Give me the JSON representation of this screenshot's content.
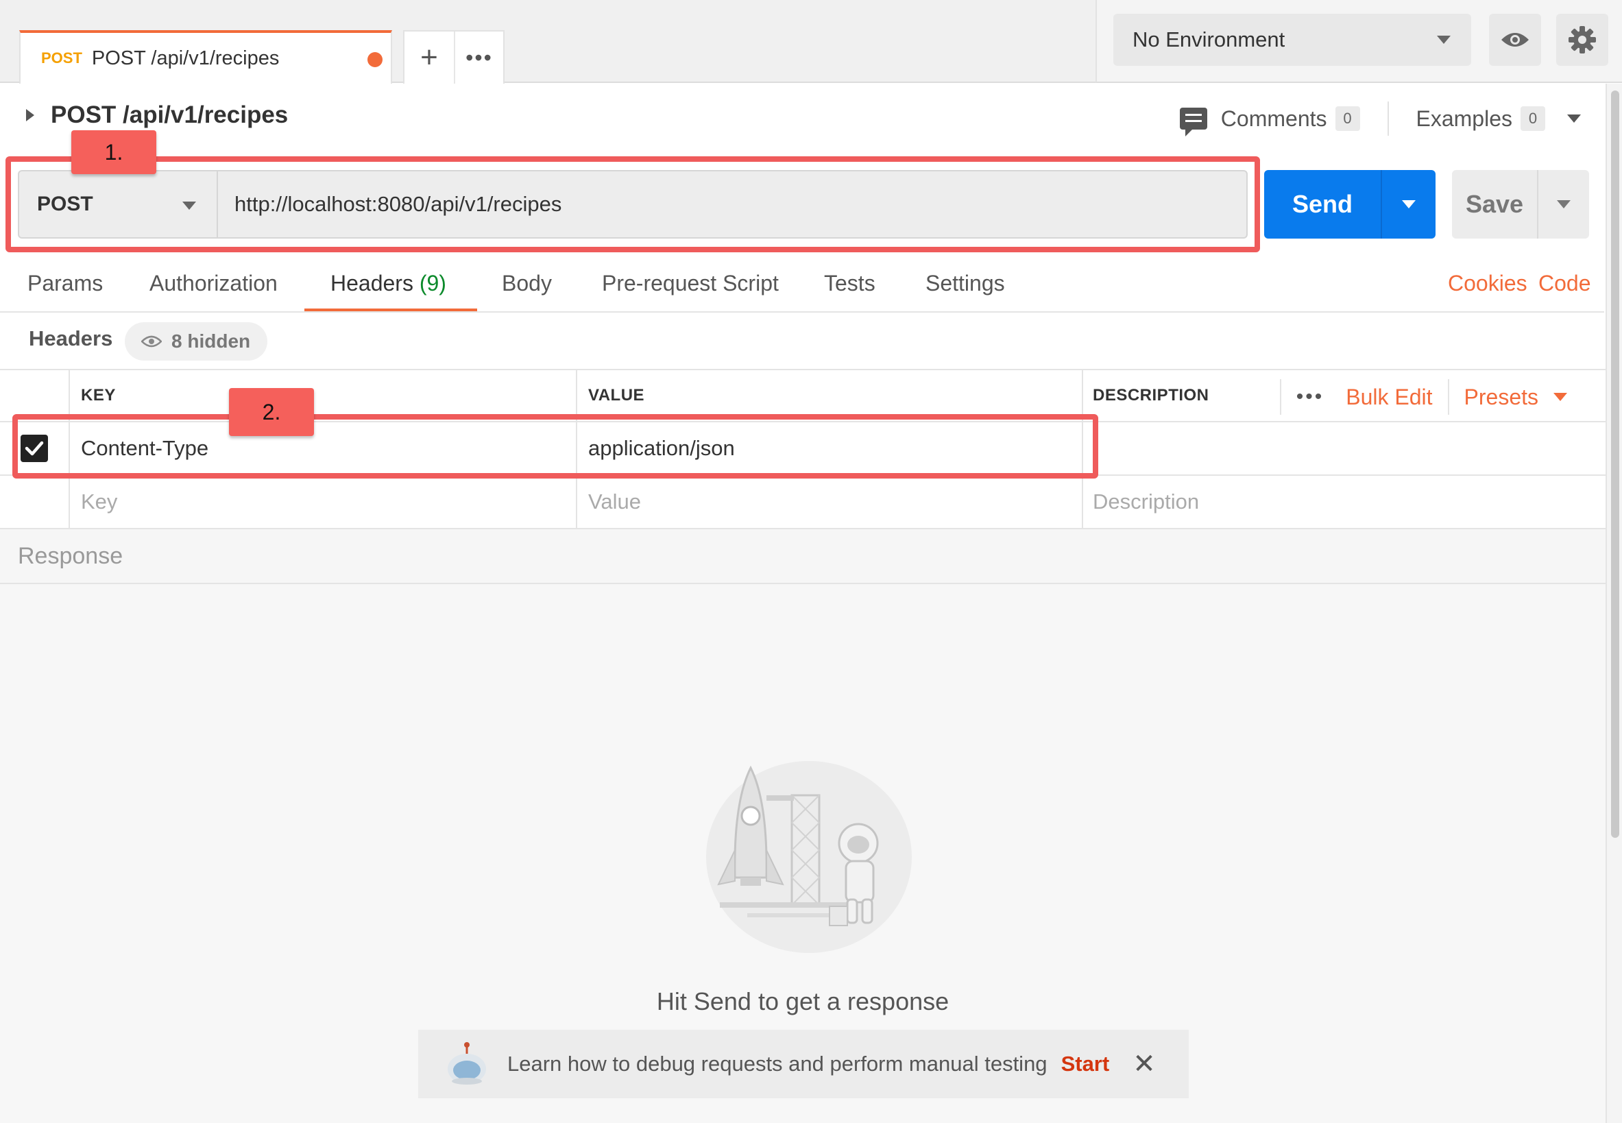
{
  "request_tab": {
    "method": "POST",
    "name": "POST /api/v1/recipes",
    "unsaved": true,
    "new_tab_symbol": "+",
    "more_symbol": "•••"
  },
  "environment": {
    "selected": "No Environment"
  },
  "request": {
    "title": "POST /api/v1/recipes",
    "comments_label": "Comments",
    "comments_count": "0",
    "examples_label": "Examples",
    "examples_count": "0",
    "method": "POST",
    "url": "http://localhost:8080/api/v1/recipes",
    "send_label": "Send",
    "save_label": "Save"
  },
  "tabs": [
    {
      "label": "Params"
    },
    {
      "label": "Authorization"
    },
    {
      "label": "Headers",
      "count": "(9)",
      "active": true
    },
    {
      "label": "Body"
    },
    {
      "label": "Pre-request Script"
    },
    {
      "label": "Tests"
    },
    {
      "label": "Settings"
    }
  ],
  "tab_links": {
    "cookies": "Cookies",
    "code": "Code"
  },
  "headers": {
    "label": "Headers",
    "hidden_label": "8 hidden",
    "columns": {
      "key": "KEY",
      "value": "VALUE",
      "description": "DESCRIPTION"
    },
    "more_symbol": "•••",
    "bulk_edit": "Bulk Edit",
    "presets": "Presets",
    "rows": [
      {
        "enabled": true,
        "key": "Content-Type",
        "value": "application/json",
        "description": ""
      }
    ],
    "placeholders": {
      "key": "Key",
      "value": "Value",
      "description": "Description"
    }
  },
  "response": {
    "label": "Response",
    "hint": "Hit Send to get a response",
    "tip": "Learn how to debug requests and perform manual testing",
    "tip_action": "Start",
    "close_symbol": "✕"
  },
  "annotations": {
    "label_1": "1.",
    "label_2": "2."
  },
  "colors": {
    "accent_orange": "#f26b3a",
    "send_blue": "#097bed",
    "annotation_red": "#ef5b5b",
    "method_yellow": "#f5a000",
    "count_green": "#0c8a2b"
  }
}
